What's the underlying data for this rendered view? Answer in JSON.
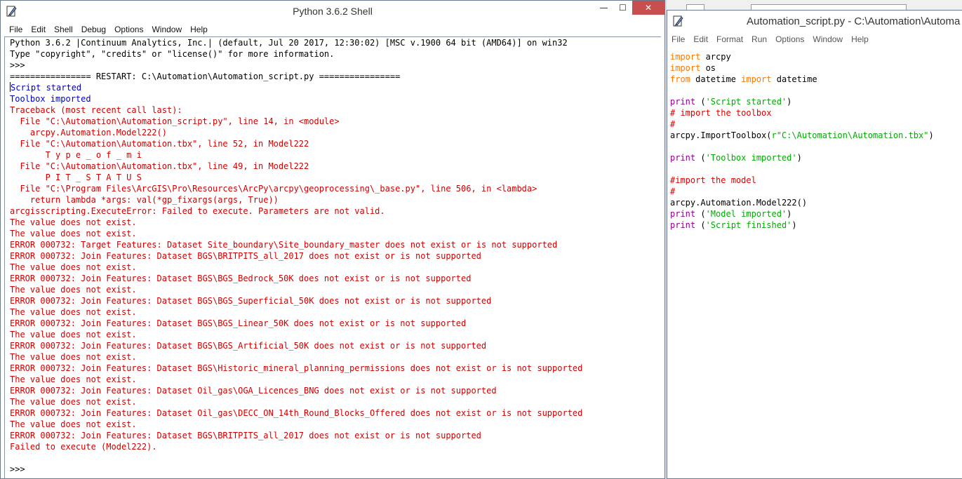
{
  "shell": {
    "title": "Python 3.6.2 Shell",
    "controls": {
      "minimize": "—",
      "maximize": "☐",
      "close": "✕"
    },
    "menu": [
      "File",
      "Edit",
      "Shell",
      "Debug",
      "Options",
      "Window",
      "Help"
    ],
    "lines": [
      {
        "text": "Python 3.6.2 |Continuum Analytics, Inc.| (default, Jul 20 2017, 12:30:02) [MSC v.1900 64 bit (AMD64)] on win32",
        "style": "black"
      },
      {
        "text": "Type \"copyright\", \"credits\" or \"license()\" for more information.",
        "style": "black"
      },
      {
        "text": ">>> ",
        "style": "black"
      },
      {
        "text": "================ RESTART: C:\\Automation\\Automation_script.py ================",
        "style": "black"
      },
      {
        "text": "Script started",
        "style": "blue"
      },
      {
        "text": "Toolbox imported",
        "style": "blue"
      },
      {
        "text": "Traceback (most recent call last):",
        "style": "red"
      },
      {
        "text": "  File \"C:\\Automation\\Automation_script.py\", line 14, in <module>",
        "style": "red"
      },
      {
        "text": "    arcpy.Automation.Model222()",
        "style": "red"
      },
      {
        "text": "  File \"C:\\Automation\\Automation.tbx\", line 52, in Model222",
        "style": "red"
      },
      {
        "text": "       T y p e _ o f _ m i",
        "style": "red"
      },
      {
        "text": "  File \"C:\\Automation\\Automation.tbx\", line 49, in Model222",
        "style": "red"
      },
      {
        "text": "       P I T _ S T A T U S",
        "style": "red"
      },
      {
        "text": "  File \"C:\\Program Files\\ArcGIS\\Pro\\Resources\\ArcPy\\arcpy\\geoprocessing\\_base.py\", line 506, in <lambda>",
        "style": "red"
      },
      {
        "text": "    return lambda *args: val(*gp_fixargs(args, True))",
        "style": "red"
      },
      {
        "text": "arcgisscripting.ExecuteError: Failed to execute. Parameters are not valid.",
        "style": "red"
      },
      {
        "text": "The value does not exist.",
        "style": "red"
      },
      {
        "text": "The value does not exist.",
        "style": "red"
      },
      {
        "text": "ERROR 000732: Target Features: Dataset Site_boundary\\Site_boundary_master does not exist or is not supported",
        "style": "red"
      },
      {
        "text": "ERROR 000732: Join Features: Dataset BGS\\BRITPITS_all_2017 does not exist or is not supported",
        "style": "red"
      },
      {
        "text": "The value does not exist.",
        "style": "red"
      },
      {
        "text": "ERROR 000732: Join Features: Dataset BGS\\BGS_Bedrock_50K does not exist or is not supported",
        "style": "red"
      },
      {
        "text": "The value does not exist.",
        "style": "red"
      },
      {
        "text": "ERROR 000732: Join Features: Dataset BGS\\BGS_Superficial_50K does not exist or is not supported",
        "style": "red"
      },
      {
        "text": "The value does not exist.",
        "style": "red"
      },
      {
        "text": "ERROR 000732: Join Features: Dataset BGS\\BGS_Linear_50K does not exist or is not supported",
        "style": "red"
      },
      {
        "text": "The value does not exist.",
        "style": "red"
      },
      {
        "text": "ERROR 000732: Join Features: Dataset BGS\\BGS_Artificial_50K does not exist or is not supported",
        "style": "red"
      },
      {
        "text": "The value does not exist.",
        "style": "red"
      },
      {
        "text": "ERROR 000732: Join Features: Dataset BGS\\Historic_mineral_planning_permissions does not exist or is not supported",
        "style": "red"
      },
      {
        "text": "The value does not exist.",
        "style": "red"
      },
      {
        "text": "ERROR 000732: Join Features: Dataset Oil_gas\\OGA_Licences_BNG does not exist or is not supported",
        "style": "red"
      },
      {
        "text": "The value does not exist.",
        "style": "red"
      },
      {
        "text": "ERROR 000732: Join Features: Dataset Oil_gas\\DECC_ON_14th_Round_Blocks_Offered does not exist or is not supported",
        "style": "red"
      },
      {
        "text": "The value does not exist.",
        "style": "red"
      },
      {
        "text": "ERROR 000732: Join Features: Dataset BGS\\BRITPITS_all_2017 does not exist or is not supported",
        "style": "red"
      },
      {
        "text": "Failed to execute (Model222).",
        "style": "red"
      },
      {
        "text": "",
        "style": "black"
      },
      {
        "text": ">>> ",
        "style": "black"
      }
    ]
  },
  "editor": {
    "title": "Automation_script.py - C:\\Automation\\Automa",
    "menu": [
      "File",
      "Edit",
      "Format",
      "Run",
      "Options",
      "Window",
      "Help"
    ],
    "lines": [
      [
        {
          "t": "import",
          "s": "kw"
        },
        {
          "t": " arcpy",
          "s": "def"
        }
      ],
      [
        {
          "t": "import",
          "s": "kw"
        },
        {
          "t": " os",
          "s": "def"
        }
      ],
      [
        {
          "t": "from",
          "s": "kw"
        },
        {
          "t": " datetime ",
          "s": "def"
        },
        {
          "t": "import",
          "s": "kw"
        },
        {
          "t": " datetime",
          "s": "def"
        }
      ],
      [
        {
          "t": "",
          "s": "def"
        }
      ],
      [
        {
          "t": "print",
          "s": "bi"
        },
        {
          "t": " (",
          "s": "def"
        },
        {
          "t": "'Script started'",
          "s": "str"
        },
        {
          "t": ")",
          "s": "def"
        }
      ],
      [
        {
          "t": "# import the toolbox",
          "s": "com"
        }
      ],
      [
        {
          "t": "#",
          "s": "com"
        }
      ],
      [
        {
          "t": "arcpy.ImportToolbox(",
          "s": "def"
        },
        {
          "t": "r\"C:\\Automation\\Automation.tbx\"",
          "s": "str"
        },
        {
          "t": ")",
          "s": "def"
        }
      ],
      [
        {
          "t": "",
          "s": "def"
        }
      ],
      [
        {
          "t": "print",
          "s": "bi"
        },
        {
          "t": " (",
          "s": "def"
        },
        {
          "t": "'Toolbox imported'",
          "s": "str"
        },
        {
          "t": ")",
          "s": "def"
        }
      ],
      [
        {
          "t": "",
          "s": "def"
        }
      ],
      [
        {
          "t": "#import the model",
          "s": "com"
        }
      ],
      [
        {
          "t": "#",
          "s": "com"
        }
      ],
      [
        {
          "t": "arcpy.Automation.Model222()",
          "s": "def"
        }
      ],
      [
        {
          "t": "print",
          "s": "bi"
        },
        {
          "t": " (",
          "s": "def"
        },
        {
          "t": "'Model imported'",
          "s": "str"
        },
        {
          "t": ")",
          "s": "def"
        }
      ],
      [
        {
          "t": "print",
          "s": "bi"
        },
        {
          "t": " (",
          "s": "def"
        },
        {
          "t": "'Script finished'",
          "s": "str"
        },
        {
          "t": ")",
          "s": "def"
        }
      ]
    ]
  },
  "colors": {
    "stdout": "#0000c0",
    "stderr": "#d00000",
    "keyword": "#ff7700",
    "string": "#00aa00",
    "comment": "#dd0000",
    "builtin": "#900090",
    "close_button": "#c74f4f"
  }
}
